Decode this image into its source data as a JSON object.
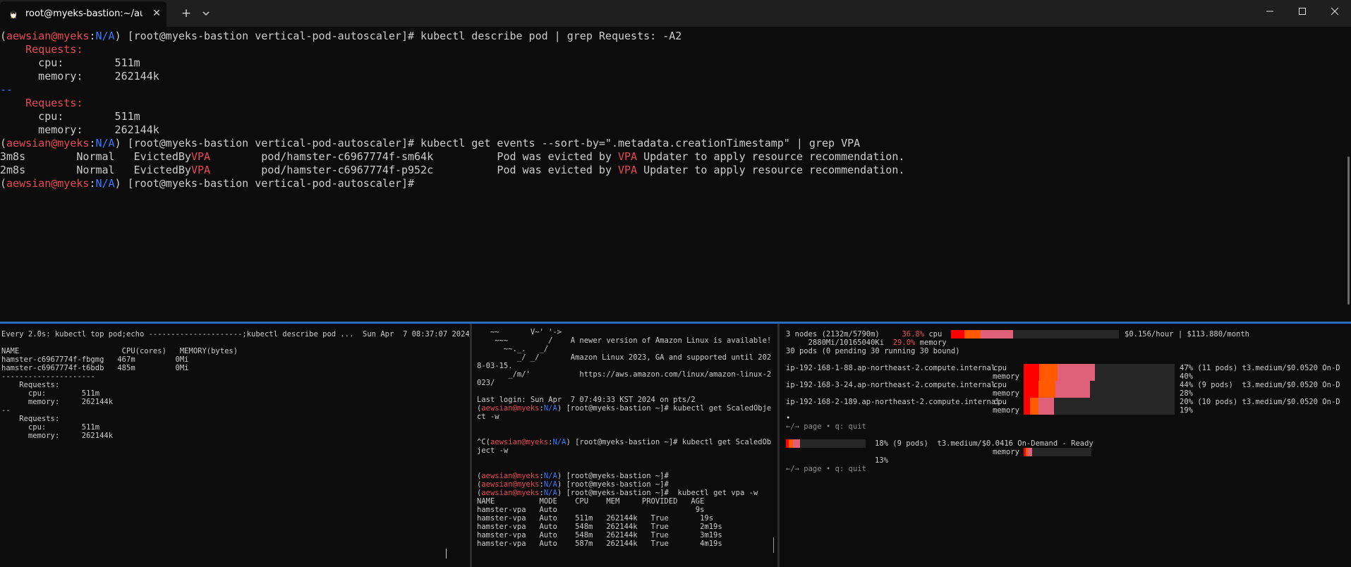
{
  "window": {
    "tab_title": "root@myeks-bastion:~/autosca",
    "tab_close": "✕",
    "new_tab": "+",
    "tab_menu_icon": "chevron-down-icon",
    "minimize_icon": "minimize-icon",
    "maximize_icon": "maximize-icon",
    "close_icon": "close-icon"
  },
  "colors": {
    "red": "#e74856",
    "blue": "#3b78ff",
    "split_active": "#2a6dbb"
  },
  "top_pane": {
    "lines": [
      [
        {
          "t": "(",
          "c": ""
        },
        {
          "t": "aewsian@myeks",
          "c": "red"
        },
        {
          "t": ":",
          "c": ""
        },
        {
          "t": "N/A",
          "c": "blue"
        },
        {
          "t": ") [root@myeks-bastion vertical-pod-autoscaler]# kubectl describe pod | grep Requests: -A2",
          "c": ""
        }
      ],
      [
        {
          "t": "    ",
          "c": ""
        },
        {
          "t": "Requests:",
          "c": "red"
        }
      ],
      [
        {
          "t": "      cpu:        511m",
          "c": ""
        }
      ],
      [
        {
          "t": "      memory:     262144k",
          "c": ""
        }
      ],
      [
        {
          "t": "--",
          "c": "blue"
        }
      ],
      [
        {
          "t": "    ",
          "c": ""
        },
        {
          "t": "Requests:",
          "c": "red"
        }
      ],
      [
        {
          "t": "      cpu:        511m",
          "c": ""
        }
      ],
      [
        {
          "t": "      memory:     262144k",
          "c": ""
        }
      ],
      [
        {
          "t": "(",
          "c": ""
        },
        {
          "t": "aewsian@myeks",
          "c": "red"
        },
        {
          "t": ":",
          "c": ""
        },
        {
          "t": "N/A",
          "c": "blue"
        },
        {
          "t": ") [root@myeks-bastion vertical-pod-autoscaler]# kubectl get events --sort-by=\".metadata.creationTimestamp\" | grep VPA",
          "c": ""
        }
      ],
      [
        {
          "t": "3m8s        Normal   EvictedBy",
          "c": ""
        },
        {
          "t": "VPA",
          "c": "red"
        },
        {
          "t": "        pod/hamster-c6967774f-sm64k          Pod was evicted by ",
          "c": ""
        },
        {
          "t": "VPA",
          "c": "red"
        },
        {
          "t": " Updater to apply resource recommendation.",
          "c": ""
        }
      ],
      [
        {
          "t": "2m8s        Normal   EvictedBy",
          "c": ""
        },
        {
          "t": "VPA",
          "c": "red"
        },
        {
          "t": "        pod/hamster-c6967774f-p952c          Pod was evicted by ",
          "c": ""
        },
        {
          "t": "VPA",
          "c": "red"
        },
        {
          "t": " Updater to apply resource recommendation.",
          "c": ""
        }
      ],
      [
        {
          "t": "(",
          "c": ""
        },
        {
          "t": "aewsian@myeks",
          "c": "red"
        },
        {
          "t": ":",
          "c": ""
        },
        {
          "t": "N/A",
          "c": "blue"
        },
        {
          "t": ") [root@myeks-bastion vertical-pod-autoscaler]# ",
          "c": ""
        }
      ]
    ]
  },
  "pane_watch": {
    "lines": [
      "Every 2.0s: kubectl top pod;echo ---------------------;kubectl describe pod ...  Sun Apr  7 08:37:07 2024",
      "",
      "NAME                       CPU(cores)   MEMORY(bytes)",
      "hamster-c6967774f-fbgmg   467m         0Mi",
      "hamster-c6967774f-t6bdb   485m         0Mi",
      "---------------------",
      "    Requests:",
      "      cpu:        511m",
      "      memory:     262144k",
      "--",
      "    Requests:",
      "      cpu:        511m",
      "      memory:     262144k"
    ]
  },
  "pane_shell": {
    "lines": [
      [
        {
          "t": "   ~~       V~' '->",
          "c": ""
        }
      ],
      [
        {
          "t": "    ~~~         /    A newer version of Amazon Linux is available!",
          "c": ""
        }
      ],
      [
        {
          "t": "      ~~._.   _/",
          "c": ""
        }
      ],
      [
        {
          "t": "         _/ _/       Amazon Linux 2023, GA and supported until 202",
          "c": ""
        }
      ],
      [
        {
          "t": "8-03-15.",
          "c": ""
        }
      ],
      [
        {
          "t": "       _/m/'           https://aws.amazon.com/linux/amazon-linux-2",
          "c": ""
        }
      ],
      [
        {
          "t": "023/",
          "c": ""
        }
      ],
      [
        {
          "t": "",
          "c": ""
        }
      ],
      [
        {
          "t": "Last login: Sun Apr  7 07:49:33 KST 2024 on pts/2",
          "c": ""
        }
      ],
      [
        {
          "t": "(",
          "c": ""
        },
        {
          "t": "aewsian@myeks",
          "c": "red"
        },
        {
          "t": ":",
          "c": ""
        },
        {
          "t": "N/A",
          "c": "blue"
        },
        {
          "t": ") [root@myeks-bastion ~]# kubectl get ScaledObje",
          "c": ""
        }
      ],
      [
        {
          "t": "ct -w",
          "c": ""
        }
      ],
      [
        {
          "t": "",
          "c": ""
        }
      ],
      [
        {
          "t": "",
          "c": ""
        }
      ],
      [
        {
          "t": "^C(",
          "c": ""
        },
        {
          "t": "aewsian@myeks",
          "c": "red"
        },
        {
          "t": ":",
          "c": ""
        },
        {
          "t": "N/A",
          "c": "blue"
        },
        {
          "t": ") [root@myeks-bastion ~]# kubectl get ScaledOb",
          "c": ""
        }
      ],
      [
        {
          "t": "ject -w",
          "c": ""
        }
      ],
      [
        {
          "t": "",
          "c": ""
        }
      ],
      [
        {
          "t": "",
          "c": ""
        }
      ],
      [
        {
          "t": "(",
          "c": ""
        },
        {
          "t": "aewsian@myeks",
          "c": "red"
        },
        {
          "t": ":",
          "c": ""
        },
        {
          "t": "N/A",
          "c": "blue"
        },
        {
          "t": ") [root@myeks-bastion ~]#",
          "c": ""
        }
      ],
      [
        {
          "t": "(",
          "c": ""
        },
        {
          "t": "aewsian@myeks",
          "c": "red"
        },
        {
          "t": ":",
          "c": ""
        },
        {
          "t": "N/A",
          "c": "blue"
        },
        {
          "t": ") [root@myeks-bastion ~]#",
          "c": ""
        }
      ],
      [
        {
          "t": "(",
          "c": ""
        },
        {
          "t": "aewsian@myeks",
          "c": "red"
        },
        {
          "t": ":",
          "c": ""
        },
        {
          "t": "N/A",
          "c": "blue"
        },
        {
          "t": ") [root@myeks-bastion ~]#  kubectl get vpa -w",
          "c": ""
        }
      ],
      [
        {
          "t": "NAME          MODE    CPU    MEM     PROVIDED   AGE",
          "c": ""
        }
      ],
      [
        {
          "t": "hamster-vpa   Auto                               9s",
          "c": ""
        }
      ],
      [
        {
          "t": "hamster-vpa   Auto    511m   262144k   True       19s",
          "c": ""
        }
      ],
      [
        {
          "t": "hamster-vpa   Auto    548m   262144k   True       2m19s",
          "c": ""
        }
      ],
      [
        {
          "t": "hamster-vpa   Auto    548m   262144k   True       3m19s",
          "c": ""
        }
      ],
      [
        {
          "t": "hamster-vpa   Auto    587m   262144k   True       4m19s",
          "c": ""
        }
      ]
    ]
  },
  "pane_viewer": {
    "summary": {
      "nodes_text": "3 nodes (2132m/5790m)",
      "cpu_pct": "36.8%",
      "cpu_label": "cpu",
      "mem_text": "     2880Mi/10165040Ki",
      "mem_pct": "29.0%",
      "mem_label": "memory",
      "cost": "$0.156/hour | $113.880/month",
      "pods": "30 pods (0 pending 30 running 30 bound)",
      "cpu_level": 0.368
    },
    "nodes": [
      {
        "name": "ip-192-168-1-88.ap-northeast-2.compute.internal",
        "cpu_label": "cpu",
        "mem_label": "memory",
        "cpu_info": "47% (11 pods) t3.medium/$0.0520 On-D",
        "mem_info": "40%",
        "cpu_level": 0.47,
        "mem_level": 0.4
      },
      {
        "name": "ip-192-168-3-24.ap-northeast-2.compute.internal",
        "cpu_label": "cpu",
        "mem_label": "memory",
        "cpu_info": "44% (9 pods)  t3.medium/$0.0520 On-D",
        "mem_info": "28%",
        "cpu_level": 0.44,
        "mem_level": 0.28
      },
      {
        "name": "ip-192-168-2-189.ap-northeast-2.compute.internal",
        "cpu_label": "cpu",
        "mem_label": "memory",
        "cpu_info": "20% (10 pods) t3.medium/$0.0520 On-D",
        "mem_info": "19%",
        "cpu_level": 0.2,
        "mem_level": 0.19
      }
    ],
    "dot": "•",
    "help": "←/→ page • q: quit",
    "node2_info": "18% (9 pods)  t3.medium/$0.0416 On-Demand - Ready",
    "node2_mem_label": "memory",
    "node2_mem_info": "13%",
    "node2_cpu_level": 0.18,
    "node2_mem_level": 0.13,
    "help2": "←/→ page • q: quit"
  }
}
